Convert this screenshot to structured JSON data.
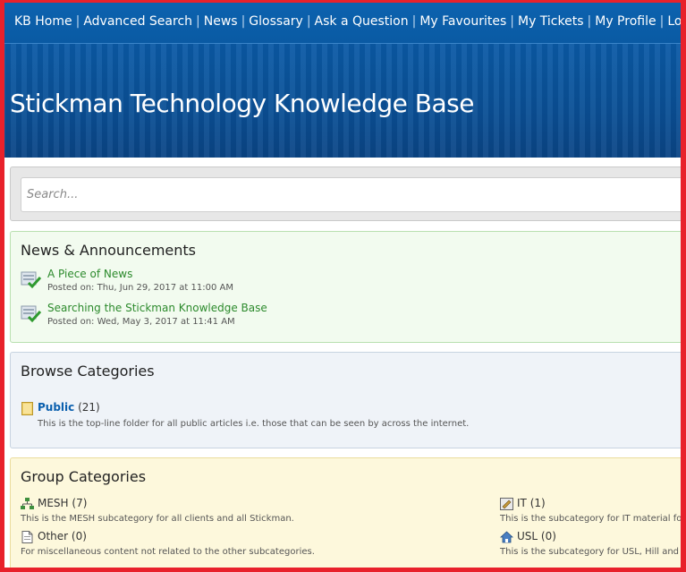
{
  "nav": {
    "items": [
      {
        "label": "KB Home"
      },
      {
        "label": "Advanced Search"
      },
      {
        "label": "News"
      },
      {
        "label": "Glossary"
      },
      {
        "label": "Ask a Question"
      },
      {
        "label": "My Favourites"
      },
      {
        "label": "My Tickets"
      },
      {
        "label": "My Profile"
      },
      {
        "label": "Logout"
      }
    ],
    "separator": "|"
  },
  "banner": {
    "title": "Stickman Technology Knowledge Base"
  },
  "search": {
    "placeholder": "Search..."
  },
  "news": {
    "heading": "News & Announcements",
    "items": [
      {
        "title": "A Piece of News",
        "date": "Posted on: Thu, Jun 29, 2017 at 11:00 AM"
      },
      {
        "title": "Searching the Stickman Knowledge Base",
        "date": "Posted on: Wed, May 3, 2017 at 11:41 AM"
      }
    ]
  },
  "browse": {
    "heading": "Browse Categories",
    "category": {
      "name": "Public",
      "count": "(21)",
      "description": "This is the top-line folder for all public articles i.e. those that can be seen by across the internet."
    }
  },
  "group": {
    "heading": "Group Categories",
    "items": [
      {
        "name": "MESH",
        "count": "(7)",
        "description": "This is the MESH subcategory for all clients and all Stickman.",
        "icon": "network-icon"
      },
      {
        "name": "IT",
        "count": "(1)",
        "description": "This is the subcategory for IT material fo",
        "icon": "edit-document-icon"
      },
      {
        "name": "Other",
        "count": "(0)",
        "description": "For miscellaneous content not related to the other subcategories.",
        "icon": "document-icon"
      },
      {
        "name": "USL",
        "count": "(0)",
        "description": "This is the subcategory for USL, Hill and",
        "icon": "home-icon"
      }
    ]
  },
  "colors": {
    "nav_bg": "#0c63b0",
    "link_green": "#2c8a2c",
    "link_blue": "#0a5fae",
    "frame_red": "#e8212b"
  }
}
